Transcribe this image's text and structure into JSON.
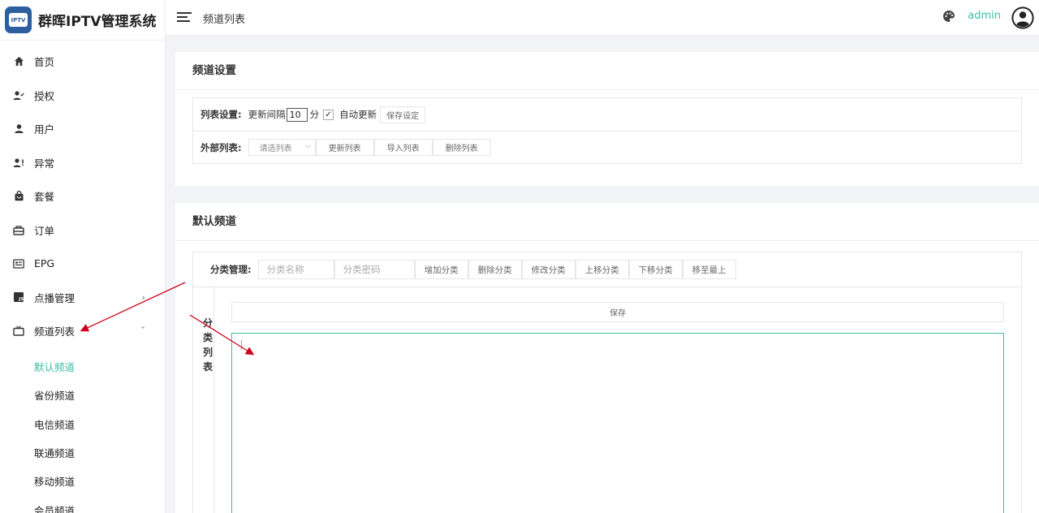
{
  "brand": {
    "logo_text": "IPTV",
    "title": "群晖IPTV管理系统"
  },
  "header": {
    "title": "频道列表",
    "username": "admin"
  },
  "menu": {
    "items": [
      {
        "label": "首页",
        "icon": "home-icon"
      },
      {
        "label": "授权",
        "icon": "user-check-icon"
      },
      {
        "label": "用户",
        "icon": "user-icon"
      },
      {
        "label": "异常",
        "icon": "user-alert-icon"
      },
      {
        "label": "套餐",
        "icon": "shopping-bag-icon"
      },
      {
        "label": "订单",
        "icon": "order-icon"
      },
      {
        "label": "EPG",
        "icon": "epg-icon"
      },
      {
        "label": "点播管理",
        "icon": "js-icon",
        "arrow": "›"
      },
      {
        "label": "频道列表",
        "icon": "tv-icon",
        "arrow": "ˇ"
      }
    ],
    "sub_items": [
      {
        "label": "默认频道",
        "active": true
      },
      {
        "label": "省份频道"
      },
      {
        "label": "电信频道"
      },
      {
        "label": "联通频道"
      },
      {
        "label": "移动频道"
      },
      {
        "label": "会员频道"
      }
    ]
  },
  "channel_settings": {
    "title": "频道设置",
    "list_settings": {
      "label": "列表设置:",
      "interval_label": "更新间隔",
      "interval_value": "10",
      "unit": "分",
      "auto_checked": true,
      "check_mark": "✓",
      "auto_label": "自动更新",
      "save_button": "保存设定"
    },
    "external_list": {
      "label": "外部列表:",
      "select_placeholder": "请选列表",
      "select_chevron": "⌵",
      "update_button": "更新列表",
      "import_button": "导入列表",
      "delete_button": "删除列表"
    }
  },
  "default_channel": {
    "title": "默认频道",
    "category_mgmt": {
      "label": "分类管理:",
      "name_placeholder": "分类名称",
      "password_placeholder": "分类密码",
      "buttons": [
        "增加分类",
        "删除分类",
        "修改分类",
        "上移分类",
        "下移分类",
        "移至最上"
      ]
    },
    "category_list_label": [
      "分",
      "类",
      "列",
      "表"
    ],
    "save_button": "保存"
  },
  "colors": {
    "accent": "#3cbfa5",
    "annotation_arrow": "#d0021b",
    "brand_logo": "#2d5f9e"
  }
}
